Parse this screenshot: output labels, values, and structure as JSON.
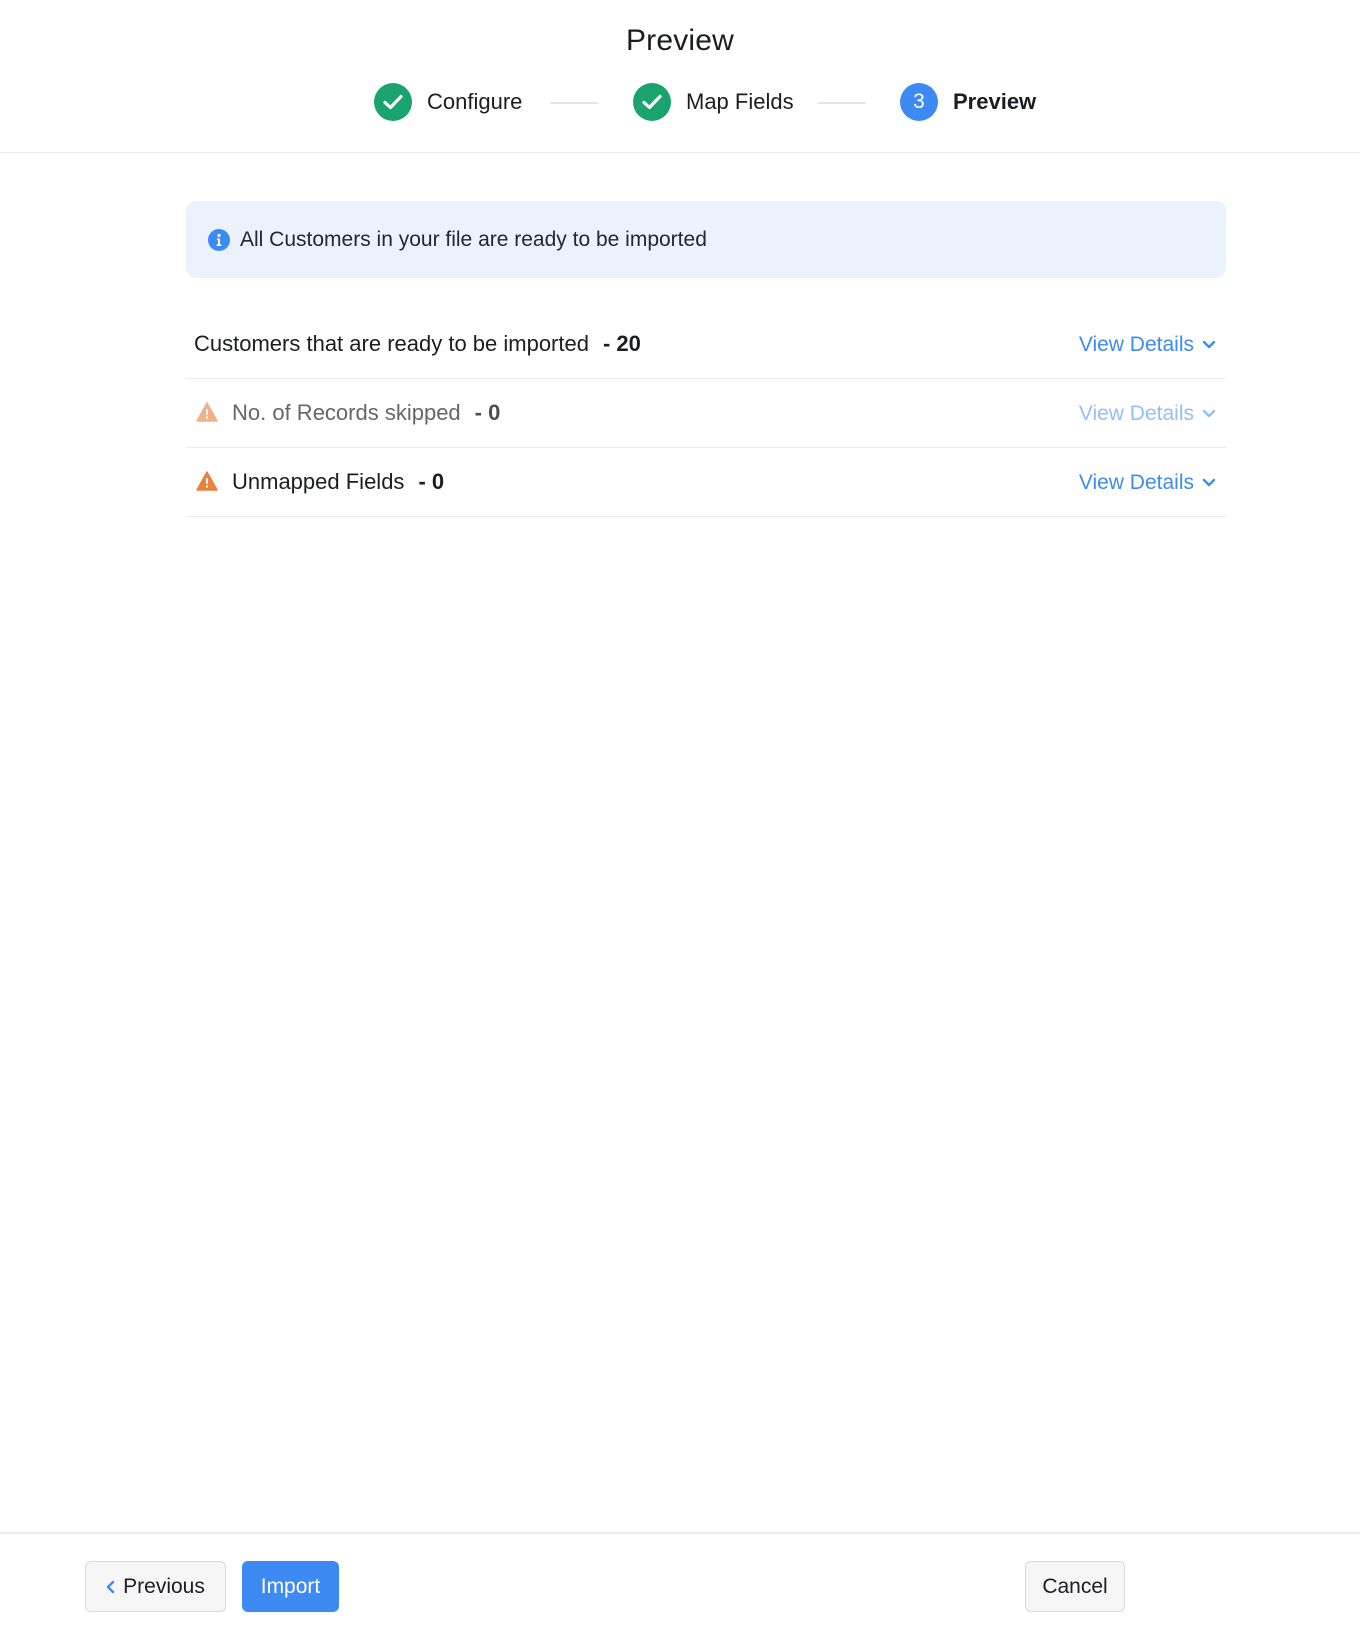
{
  "page": {
    "title": "Preview"
  },
  "stepper": {
    "steps": [
      {
        "label": "Configure",
        "status": "done"
      },
      {
        "label": "Map Fields",
        "status": "done"
      },
      {
        "label": "Preview",
        "status": "current",
        "number": "3"
      }
    ]
  },
  "banner": {
    "icon": "info-icon",
    "text": "All Customers in your file are ready to be imported"
  },
  "summary": {
    "rows": [
      {
        "label": "Customers that are ready to be imported",
        "count": "- 20",
        "link": "View Details",
        "icon": null
      },
      {
        "label": "No. of Records skipped",
        "count": "- 0",
        "link": "View Details",
        "icon": "warning-icon"
      },
      {
        "label": "Unmapped Fields",
        "count": "- 0",
        "link": "View Details",
        "icon": "warning-icon"
      }
    ]
  },
  "footer": {
    "previous_label": "Previous",
    "import_label": "Import",
    "cancel_label": "Cancel"
  },
  "colors": {
    "primary": "#3d8bf2",
    "success": "#1aa36f",
    "warning": "#e9813f",
    "banner_bg": "#ebf2fd"
  }
}
